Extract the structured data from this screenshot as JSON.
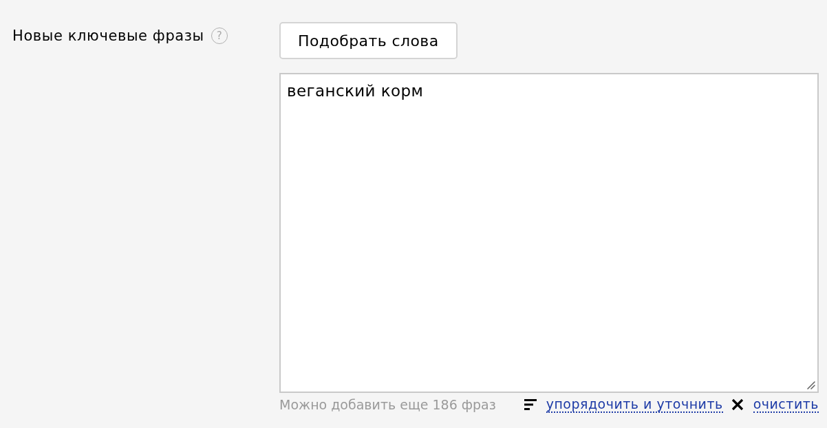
{
  "field": {
    "label": "Новые ключевые фразы",
    "help": "?"
  },
  "pick_words_button": "Подобрать слова",
  "phrases": {
    "value": "веганский корм"
  },
  "hint": "Можно добавить еще 186 фраз",
  "actions": [
    {
      "kind": "sort",
      "label": "упорядочить и уточнить"
    },
    {
      "kind": "clear",
      "label": "очистить"
    }
  ]
}
